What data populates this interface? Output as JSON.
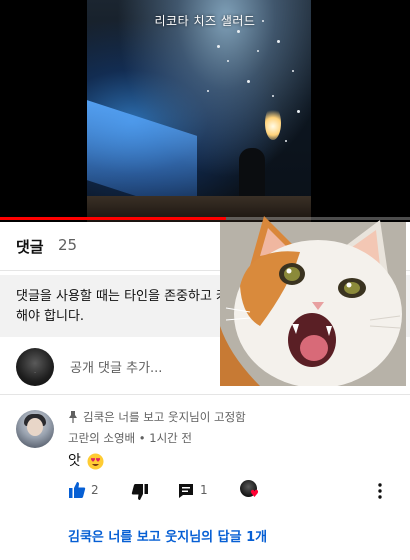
{
  "video": {
    "caption": "리코타 치즈 샐러드",
    "progress": 0.55,
    "accent": "#ff0000"
  },
  "comments": {
    "title": "댓글",
    "count": "25",
    "sort_icon": "sort-icon",
    "close_icon": "close-icon",
    "notice": "댓글을 사용할 때는 타인을 존중하고 커뮤니티 가이드를 준수해야 합니다.",
    "add_placeholder": "공개 댓글 추가...",
    "items": [
      {
        "pinned_label": "김쿡은 너를 보고 웃지님이 고정함",
        "author": "고란의 소영배",
        "time": "1시간 전",
        "separator": "•",
        "text": "앗",
        "emoji": "heart-eyes-emoji",
        "likes": "2",
        "replies": "1",
        "view_replies": "김쿡은 너를 보고 웃지님의 답글 1개"
      }
    ]
  },
  "overlay": {
    "sticker": "screaming-cat-sticker"
  },
  "colors": {
    "link": "#065fd4",
    "secondary_text": "#606060",
    "notice_bg": "#f2f2f2"
  }
}
